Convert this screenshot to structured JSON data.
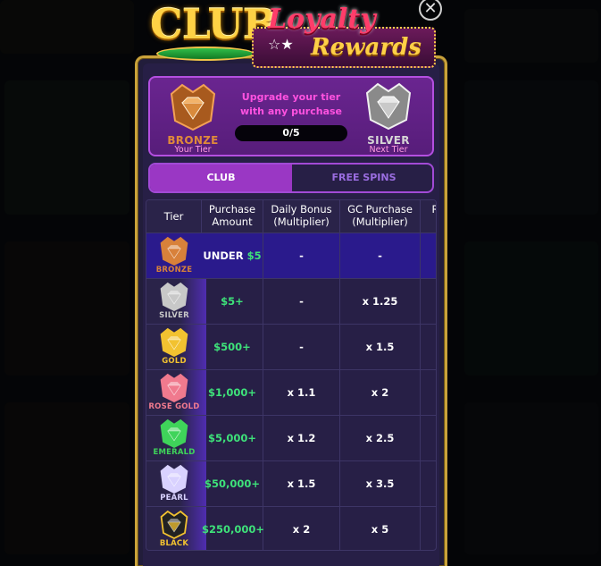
{
  "logo": {
    "club": "CLUB",
    "loyalty": "Loyalty",
    "rewards": "Rewards"
  },
  "close_icon": "close-icon",
  "tier_card": {
    "current_name": "BRONZE",
    "current_sub": "Your Tier",
    "next_name": "SILVER",
    "next_sub": "Next Tier",
    "upgrade_text": "Upgrade your tier with any purchase",
    "progress": "0/5"
  },
  "tabs": [
    {
      "label": "CLUB",
      "active": true
    },
    {
      "label": "FREE SPINS",
      "active": false
    }
  ],
  "table": {
    "headers": [
      "Tier",
      "Purchase Amount",
      "Daily Bonus (Multiplier)",
      "GC Purchase (Multiplier)",
      "R"
    ],
    "rows": [
      {
        "tier": "BRONZE",
        "amount_prefix": "UNDER ",
        "amount": "$5",
        "daily": "-",
        "gc": "-",
        "color": "#d8813a",
        "active": true
      },
      {
        "tier": "SILVER",
        "amount_prefix": "",
        "amount": "$5+",
        "daily": "-",
        "gc": "x 1.25",
        "color": "#c8c8c8",
        "active": false
      },
      {
        "tier": "GOLD",
        "amount_prefix": "",
        "amount": "$500+",
        "daily": "-",
        "gc": "x 1.5",
        "color": "#f2c230",
        "active": false
      },
      {
        "tier": "ROSE GOLD",
        "amount_prefix": "",
        "amount": "$1,000+",
        "daily": "x 1.1",
        "gc": "x 2",
        "color": "#f07a8e",
        "active": false
      },
      {
        "tier": "EMERALD",
        "amount_prefix": "",
        "amount": "$5,000+",
        "daily": "x 1.2",
        "gc": "x 2.5",
        "color": "#3fd45a",
        "active": false
      },
      {
        "tier": "PEARL",
        "amount_prefix": "",
        "amount": "$50,000+",
        "daily": "x 1.5",
        "gc": "x 3.5",
        "color": "#d9d2ff",
        "active": false
      },
      {
        "tier": "BLACK",
        "amount_prefix": "",
        "amount": "$250,000+",
        "daily": "x 2",
        "gc": "x 5",
        "color": "#f2c230",
        "active": false
      }
    ]
  },
  "colors": {
    "accent": "#9a37c4",
    "green": "#3ee27a",
    "panel": "#271f46"
  }
}
